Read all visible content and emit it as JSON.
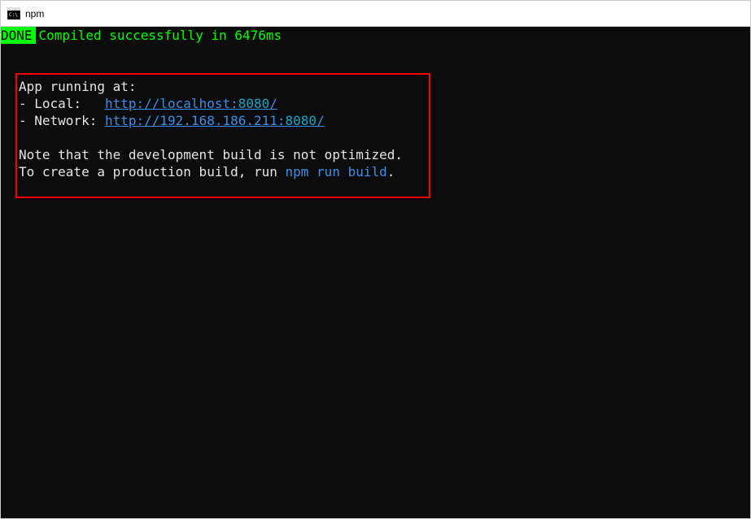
{
  "titlebar": {
    "title": "npm"
  },
  "terminal": {
    "status": {
      "badge": " DONE ",
      "message": " Compiled successfully in 6476ms"
    },
    "box": {
      "intro": "App running at:",
      "local_label": "- Local:   ",
      "local_url_prefix": "http://localhost:",
      "local_port": "8080",
      "local_url_suffix": "/",
      "network_label": "- Network: ",
      "network_url_prefix": "http://192.168.186.211:",
      "network_port": "8080",
      "network_url_suffix": "/",
      "note1": "Note that the development build is not optimized.",
      "note2_pre": "To create a production build, run ",
      "note2_cmd": "npm run build",
      "note2_post": "."
    }
  }
}
